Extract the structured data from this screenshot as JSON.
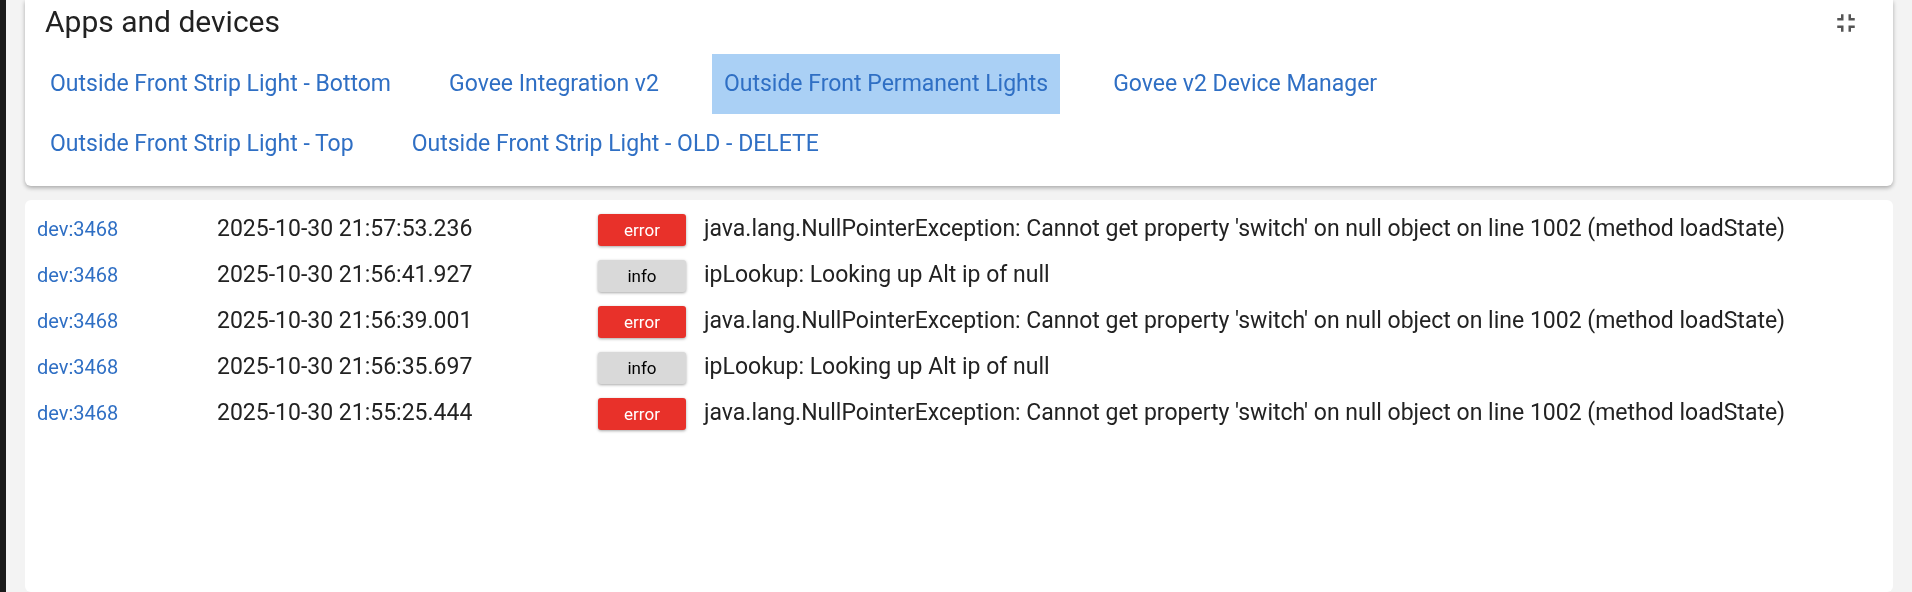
{
  "panel": {
    "title": "Apps and devices",
    "links": [
      {
        "label": "Outside Front Strip Light - Bottom",
        "selected": false
      },
      {
        "label": "Govee Integration v2",
        "selected": false
      },
      {
        "label": "Outside Front Permanent Lights",
        "selected": true
      },
      {
        "label": "Govee v2 Device Manager",
        "selected": false
      },
      {
        "label": "Outside Front Strip Light - Top",
        "selected": false
      },
      {
        "label": "Outside Front Strip Light - OLD - DELETE",
        "selected": false
      }
    ]
  },
  "log": [
    {
      "source": "dev:3468",
      "time": "2025-10-30 21:57:53.236",
      "level": "error",
      "message": "java.lang.NullPointerException: Cannot get property 'switch' on null object on line 1002 (method loadState)"
    },
    {
      "source": "dev:3468",
      "time": "2025-10-30 21:56:41.927",
      "level": "info",
      "message": "ipLookup: Looking up Alt ip of null"
    },
    {
      "source": "dev:3468",
      "time": "2025-10-30 21:56:39.001",
      "level": "error",
      "message": "java.lang.NullPointerException: Cannot get property 'switch' on null object on line 1002 (method loadState)"
    },
    {
      "source": "dev:3468",
      "time": "2025-10-30 21:56:35.697",
      "level": "info",
      "message": "ipLookup: Looking up Alt ip of null"
    },
    {
      "source": "dev:3468",
      "time": "2025-10-30 21:55:25.444",
      "level": "error",
      "message": "java.lang.NullPointerException: Cannot get property 'switch' on null object on line 1002 (method loadState)"
    }
  ]
}
